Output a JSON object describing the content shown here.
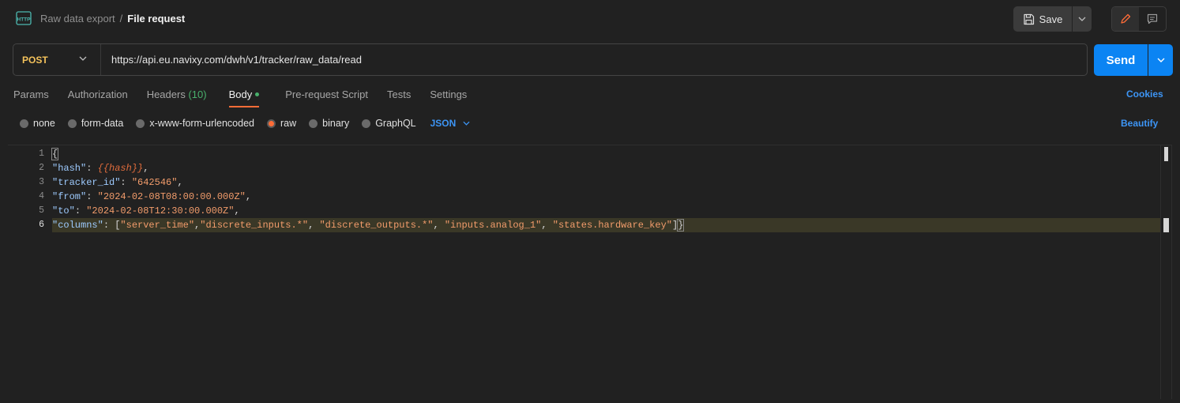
{
  "header": {
    "icon": "http-icon",
    "breadcrumb_parent": "Raw data export",
    "breadcrumb_separator": "/",
    "breadcrumb_current": "File request",
    "save_label": "Save"
  },
  "request": {
    "method": "POST",
    "url": "https://api.eu.navixy.com/dwh/v1/tracker/raw_data/read",
    "send_label": "Send"
  },
  "tabs": [
    {
      "label": "Params"
    },
    {
      "label": "Authorization"
    },
    {
      "label": "Headers",
      "count": "(10)"
    },
    {
      "label": "Body"
    },
    {
      "label": "Pre-request Script"
    },
    {
      "label": "Tests"
    },
    {
      "label": "Settings"
    }
  ],
  "cookies_label": "Cookies",
  "body_types": [
    {
      "label": "none"
    },
    {
      "label": "form-data"
    },
    {
      "label": "x-www-form-urlencoded"
    },
    {
      "label": "raw"
    },
    {
      "label": "binary"
    },
    {
      "label": "GraphQL"
    }
  ],
  "raw_format": "JSON",
  "beautify_label": "Beautify",
  "editor": {
    "line_numbers": [
      "1",
      "2",
      "3",
      "4",
      "5",
      "6"
    ],
    "line1": "{",
    "line2_key": "\"hash\"",
    "line2_value": "{{hash}}",
    "line3_key": "\"tracker_id\"",
    "line3_value": "\"642546\"",
    "line4_key": "\"from\"",
    "line4_value": "\"2024-02-08T08:00:00.000Z\"",
    "line5_key": "\"to\"",
    "line5_value": "\"2024-02-08T12:30:00.000Z\"",
    "line6_key": "\"columns\"",
    "line6_v1": "\"server_time\"",
    "line6_v2": "\"discrete_inputs.*\"",
    "line6_v3": "\"discrete_outputs.*\"",
    "line6_v4": "\"inputs.analog_1\"",
    "line6_v5": "\"states.hardware_key\"",
    "line6_close": "}"
  },
  "colors": {
    "accent_orange": "#ff6c37",
    "send_blue": "#0b84f3",
    "link_blue": "#3d95f5",
    "method_yellow": "#f4c25b",
    "success_green": "#49b06c"
  }
}
